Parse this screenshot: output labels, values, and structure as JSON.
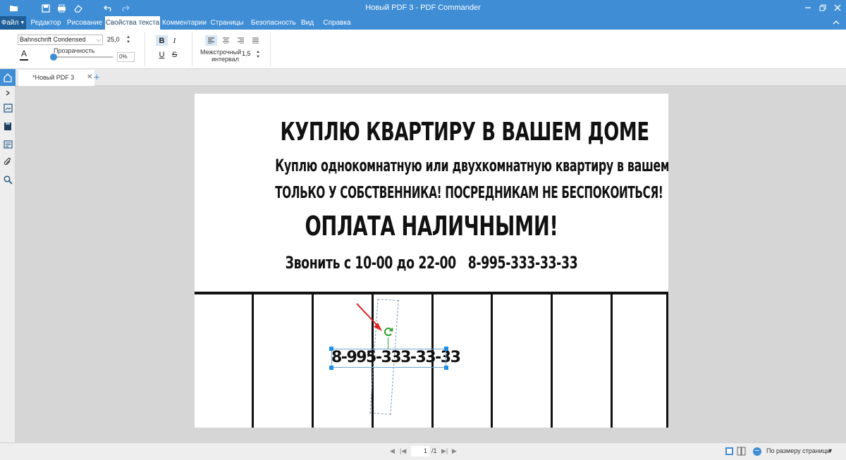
{
  "window": {
    "title": "Новый PDF 3 - PDF Commander"
  },
  "ribbon_tabs": {
    "file": "Файл",
    "items": [
      "Редактор",
      "Рисование",
      "Свойства текста",
      "Комментарии",
      "Страницы",
      "Безопасность",
      "Вид",
      "Справка"
    ],
    "active": "Свойства текста"
  },
  "text_props": {
    "font": "Bahnschrift Condensed",
    "size": "25,0",
    "font_color_glyph": "A",
    "opacity_label": "Прозрачность",
    "opacity_value": "0%",
    "opacity_level": 0,
    "bold": "B",
    "italic": "I",
    "underline": "U",
    "strike": "S",
    "line_spacing_label_1": "Межстрочный",
    "line_spacing_label_2": "интервал",
    "line_spacing_value": "1,5"
  },
  "doc_tab": {
    "label": "*Новый PDF 3"
  },
  "page": {
    "line1": "КУПЛЮ КВАРТИРУ В ВАШЕМ ДОМЕ",
    "line2": "Куплю однокомнатную или двухкомнатную квартиру в вашем доме.",
    "line3": "ТОЛЬКО У СОБСТВЕННИКА! ПОСРЕДНИКАМ НЕ БЕСПОКОИТЬСЯ!",
    "line4": "ОПЛАТА НАЛИЧНЫМИ!",
    "line5": "Звонить с 10-00 до 22-00   8-995-333-33-33",
    "selected_text": "8-995-333-33-33"
  },
  "statusbar": {
    "page_current": "1",
    "page_total": "/1",
    "zoom_mode": "По размеру страницы"
  },
  "colors": {
    "accent": "#3f8dd5",
    "file_button": "#1f5f99",
    "rotate_handle": "#2ca02c",
    "arrow": "#e02424"
  }
}
